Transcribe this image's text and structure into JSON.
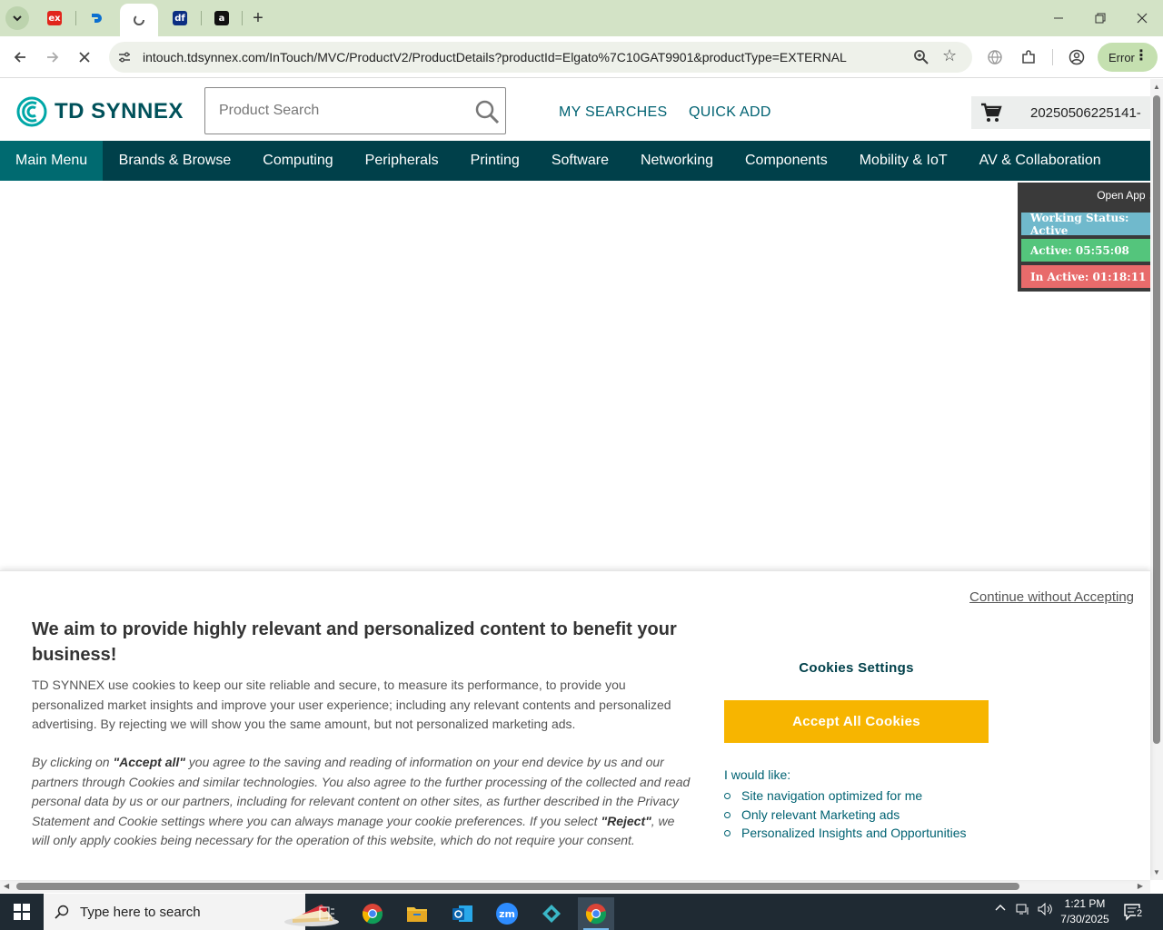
{
  "browser": {
    "tabs": [
      {
        "icon": "expedia-icon",
        "label": "ex"
      },
      {
        "icon": "dell-icon",
        "label": ""
      },
      {
        "icon": "tdsynnex-icon",
        "label": ""
      },
      {
        "icon": "df-icon",
        "label": "df"
      },
      {
        "icon": "amazon-icon",
        "label": "a"
      }
    ],
    "new_tab_label": "+",
    "url": "intouch.tdsynnex.com/InTouch/MVC/ProductV2/ProductDetails?productId=Elgato%7C10GAT9901&productType=EXTERNAL",
    "profile_status": "Error"
  },
  "header": {
    "logo_text": "TD SYNNEX",
    "search_placeholder": "Product Search",
    "my_searches": "MY SEARCHES",
    "quick_add": "QUICK ADD",
    "cart_id": "20250506225141-"
  },
  "nav": {
    "items": [
      "Main Menu",
      "Brands & Browse",
      "Computing",
      "Peripherals",
      "Printing",
      "Software",
      "Networking",
      "Components",
      "Mobility & IoT",
      "AV & Collaboration"
    ]
  },
  "status_widget": {
    "open_app": "Open App ↗",
    "working_status": "Working Status: Active",
    "active": "Active: 05:55:08",
    "inactive": "In Active: 01:18:11",
    "colors": {
      "working": "#70b9cc",
      "active": "#54c57c",
      "inactive": "#e86b6b"
    }
  },
  "cookie": {
    "continue_without": "Continue without Accepting",
    "heading": "We aim to provide highly relevant and personalized content to benefit your business!",
    "paragraph1": "TD SYNNEX use cookies to keep our site reliable and secure, to measure its performance, to provide you personalized market insights and improve your user experience; including any relevant contents and personalized advertising. By rejecting we will show you the same amount, but not personalized marketing ads.",
    "p2_part1": "By clicking on ",
    "p2_accept": "\"Accept all\"",
    "p2_part2": " you agree to the saving and reading of information on your end device by us and our partners through Cookies and similar technologies. You also agree to the further processing of the collected and read personal data by us or our partners, including for relevant content on other sites, as further described in the Privacy Statement and Cookie settings where you can always manage your cookie preferences. If you select ",
    "p2_reject": "\"Reject\"",
    "p2_part3": ", we will only apply cookies being necessary for the operation of this website, which do not require your consent.",
    "settings": "Cookies Settings",
    "accept_all": "Accept All Cookies",
    "i_would_like": "I would like:",
    "preferences": [
      "Site navigation optimized for me",
      "Only relevant Marketing ads",
      "Personalized Insights and Opportunities"
    ],
    "accent_color": "#f7b500"
  },
  "taskbar": {
    "search_text": "Type here to search",
    "time": "1:21 PM",
    "date": "7/30/2025",
    "notification_count": "2"
  }
}
